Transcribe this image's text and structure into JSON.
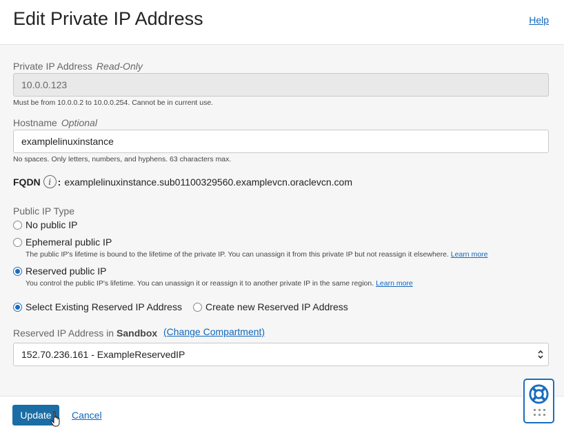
{
  "header": {
    "title": "Edit Private IP Address",
    "help_label": "Help"
  },
  "private_ip": {
    "label": "Private IP Address",
    "tag": "Read-Only",
    "value": "10.0.0.123",
    "help": "Must be from 10.0.0.2 to 10.0.0.254. Cannot be in current use."
  },
  "hostname": {
    "label": "Hostname",
    "tag": "Optional",
    "value": "examplelinuxinstance",
    "help": "No spaces. Only letters, numbers, and hyphens. 63 characters max."
  },
  "fqdn": {
    "label": "FQDN",
    "info_icon": "i",
    "value": "examplelinuxinstance.sub01100329560.examplevcn.oraclevcn.com"
  },
  "public_ip_type": {
    "label": "Public IP Type",
    "options": [
      {
        "label": "No public IP",
        "checked": false,
        "description": ""
      },
      {
        "label": "Ephemeral public IP",
        "checked": false,
        "description": "The public IP's lifetime is bound to the lifetime of the private IP. You can unassign it from this private IP but not reassign it elsewhere.",
        "learn_more": "Learn more"
      },
      {
        "label": "Reserved public IP",
        "checked": true,
        "description": "You control the public IP's lifetime. You can unassign it or reassign it to another private IP in the same region.",
        "learn_more": "Learn more"
      }
    ]
  },
  "reserved_source": {
    "options": [
      {
        "label": "Select Existing Reserved IP Address",
        "checked": true
      },
      {
        "label": "Create new Reserved IP Address",
        "checked": false
      }
    ]
  },
  "reserved_ip": {
    "label": "Reserved IP Address in",
    "compartment": "Sandbox",
    "change_compartment": "(Change Compartment)",
    "selected": "152.70.236.161 - ExampleReservedIP"
  },
  "footer": {
    "update_label": "Update",
    "cancel_label": "Cancel"
  },
  "colors": {
    "accent": "#1a6dbf",
    "link": "#1166bb",
    "primary_button": "#1a6da5"
  }
}
